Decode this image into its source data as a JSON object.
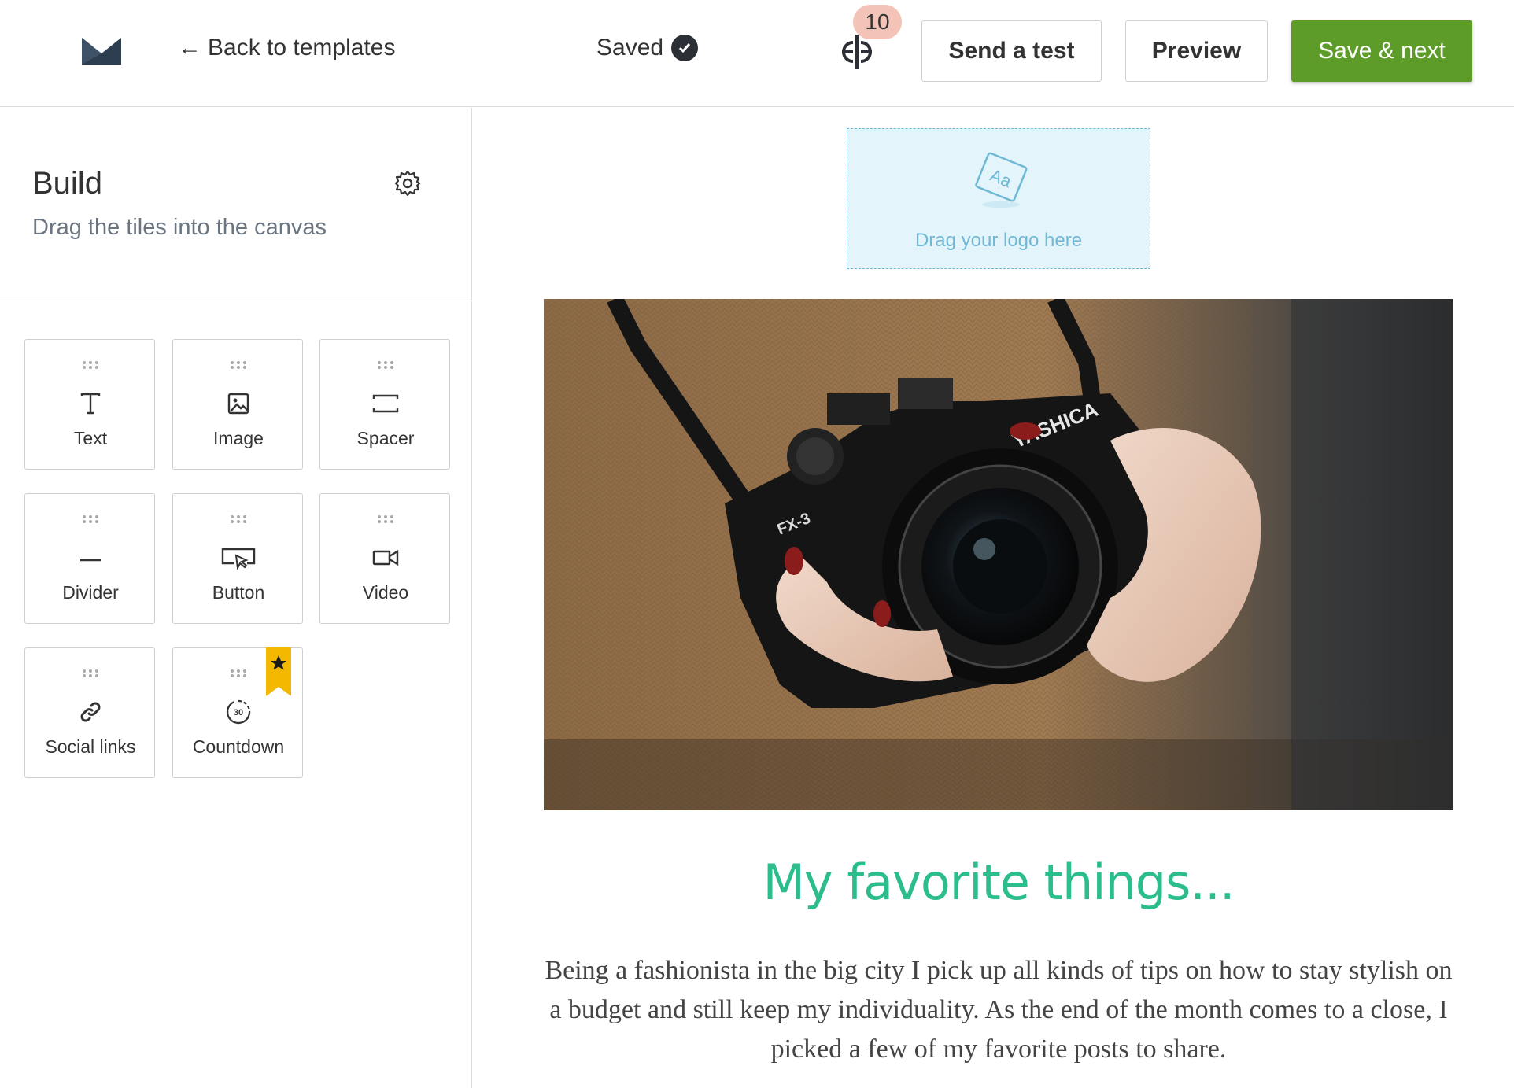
{
  "header": {
    "logo_icon": "mail-envelope-logo",
    "back_label": "Back to templates",
    "saved_label": "Saved",
    "ab_icon": "ab-split-icon",
    "ab_badge": "10",
    "send_test_label": "Send a test",
    "preview_label": "Preview",
    "save_next_label": "Save & next",
    "colors": {
      "save_button": "#5e9c2a",
      "badge": "#f3c3b8"
    }
  },
  "sidebar": {
    "title": "Build",
    "subtitle": "Drag the tiles into the canvas",
    "tiles": [
      {
        "label": "Text",
        "icon": "text-icon"
      },
      {
        "label": "Image",
        "icon": "image-icon"
      },
      {
        "label": "Spacer",
        "icon": "spacer-icon"
      },
      {
        "label": "Divider",
        "icon": "divider-icon"
      },
      {
        "label": "Button",
        "icon": "button-icon"
      },
      {
        "label": "Video",
        "icon": "video-icon"
      },
      {
        "label": "Social links",
        "icon": "link-icon"
      },
      {
        "label": "Countdown",
        "icon": "countdown-icon",
        "countdown_value": "30",
        "premium": true
      }
    ]
  },
  "canvas": {
    "logo_drop_label": "Drag your logo here",
    "logo_drop_icon_text": "Aa",
    "camera_brand_text": "YASHICA",
    "camera_model_text": "FX-3",
    "headline": "My favorite things...",
    "body": "Being a fashionista in the big city I pick up all kinds of tips on how to stay stylish on a budget and still keep my individuality. As the end of the month comes to a close, I picked a few of my favorite posts to share.",
    "colors": {
      "headline": "#2bbd8c",
      "logo_drop_bg": "#e4f4fb"
    }
  }
}
